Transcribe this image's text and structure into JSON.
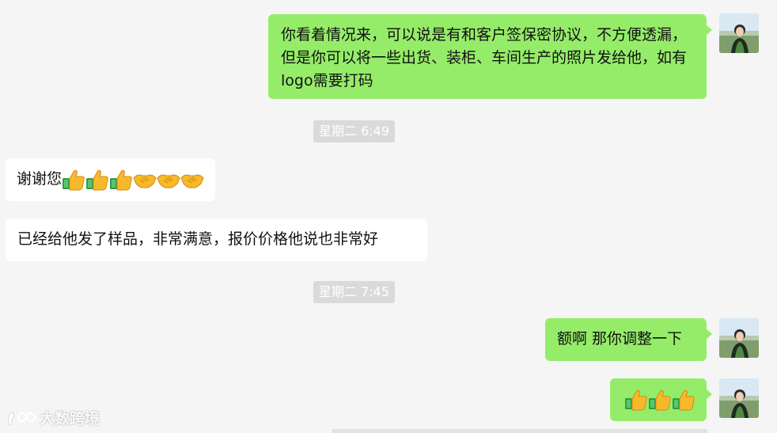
{
  "messages": [
    {
      "id": "m1",
      "side": "me",
      "text": "你看着情况来，可以说是有和客户签保密协议，不方便透漏，但是你可以将一些出货、装柜、车间生产的照片发给他，如有logo需要打码"
    },
    {
      "id": "t1",
      "type": "time",
      "text": "星期二 6:49"
    },
    {
      "id": "m2",
      "side": "them",
      "text": "谢谢您",
      "emojis": [
        "thumbs-up",
        "thumbs-up",
        "thumbs-up",
        "handshake",
        "handshake",
        "handshake"
      ]
    },
    {
      "id": "m3",
      "side": "them",
      "text": "已经给他发了样品，非常满意，报价价格他说也非常好"
    },
    {
      "id": "t2",
      "type": "time",
      "text": "星期二 7:45"
    },
    {
      "id": "m4",
      "side": "me",
      "text": "额啊 那你调整一下"
    },
    {
      "id": "m5",
      "side": "me",
      "text": "",
      "emojis": [
        "thumbs-up",
        "thumbs-up",
        "thumbs-up"
      ]
    }
  ],
  "watermark": {
    "text": "大数跨境"
  },
  "colors": {
    "me_bubble": "#95ec69",
    "them_bubble": "#ffffff",
    "background": "#f5f5f5",
    "time_badge": "#dadada"
  }
}
